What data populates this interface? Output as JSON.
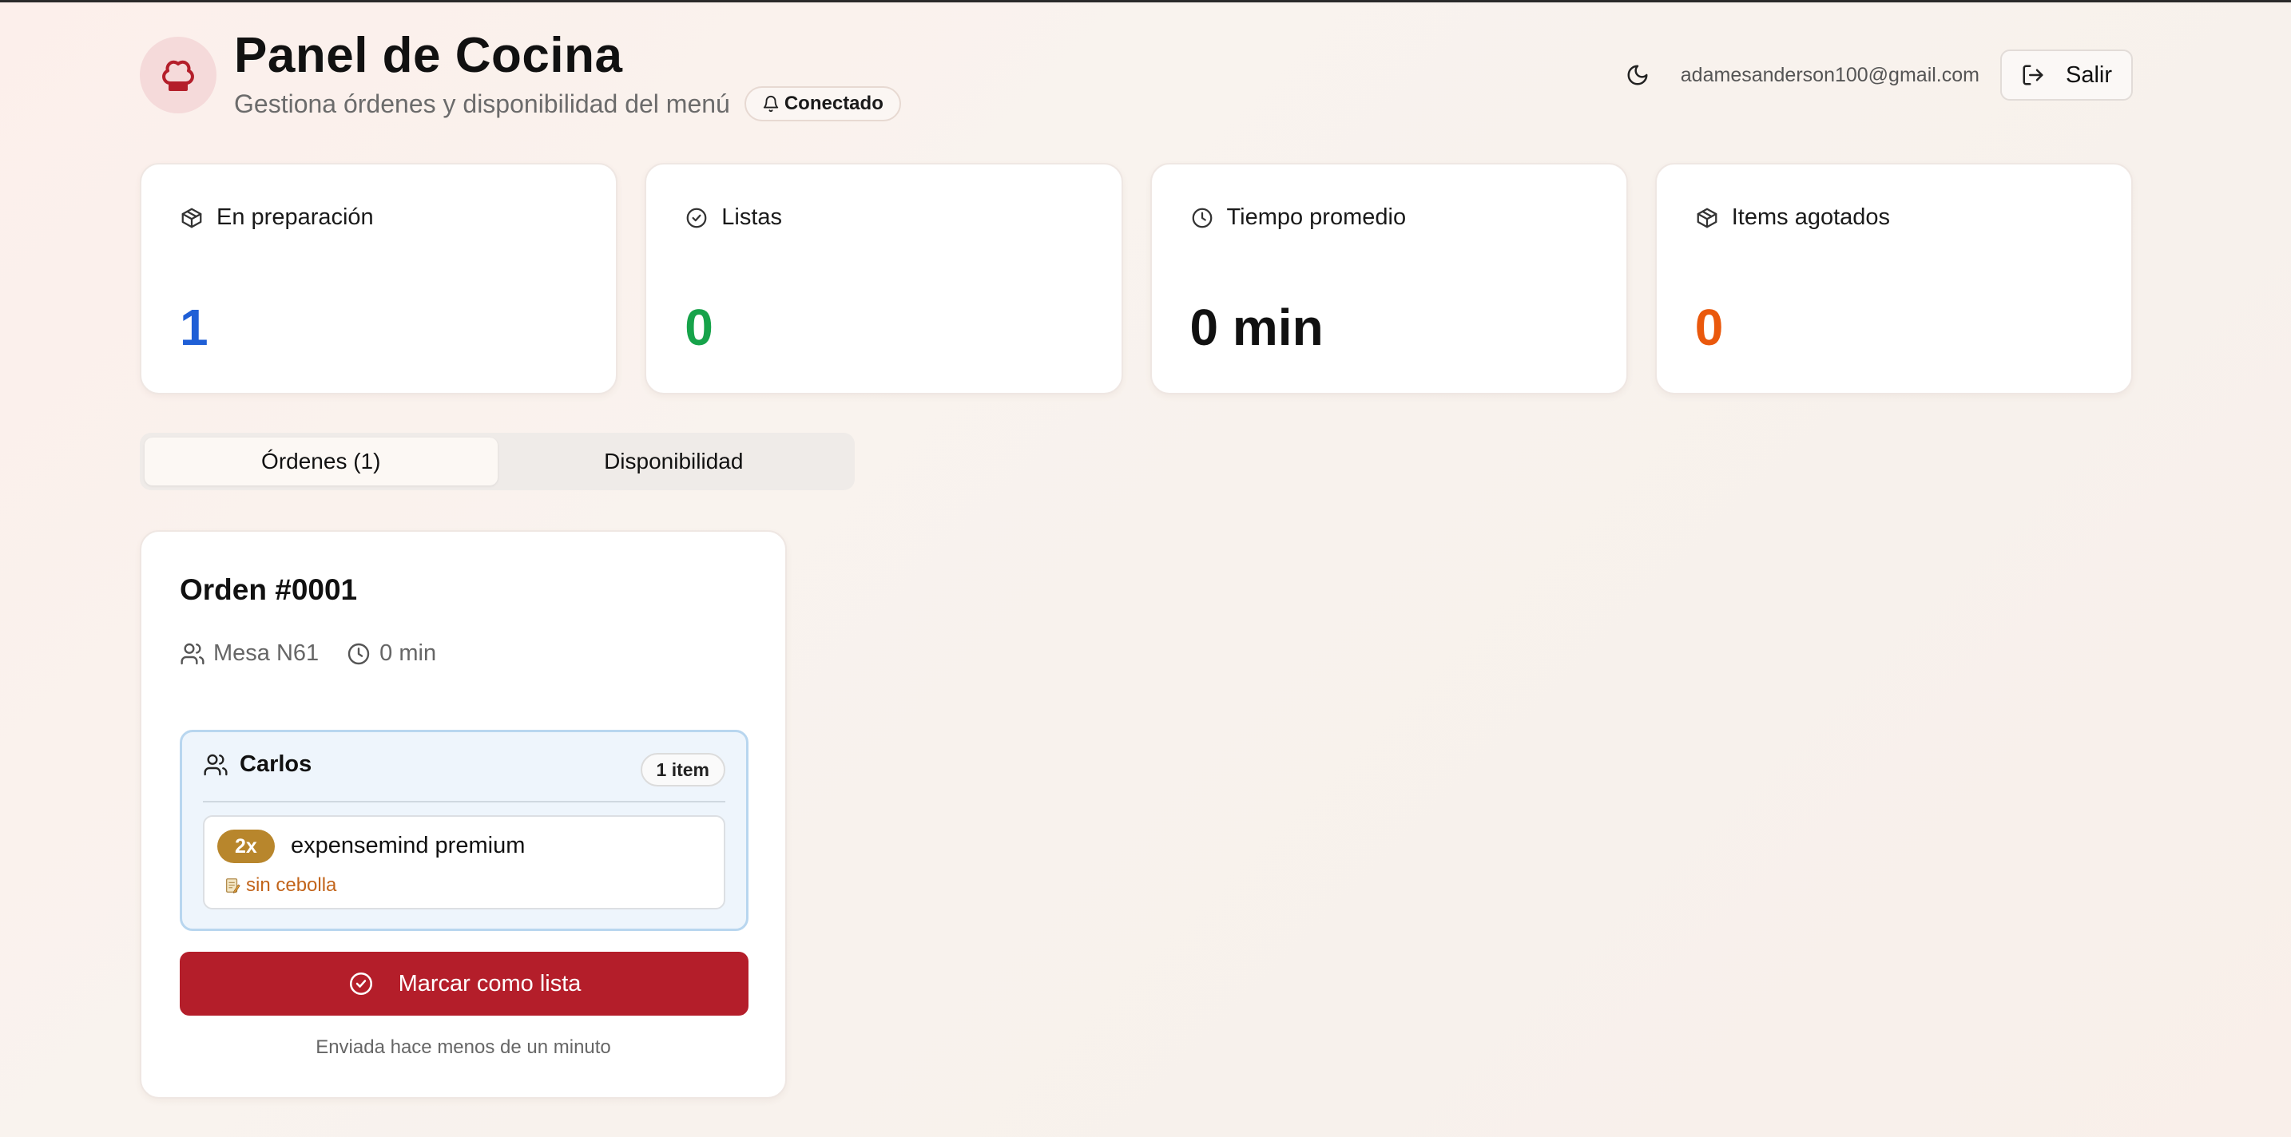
{
  "header": {
    "title": "Panel de Cocina",
    "subtitle": "Gestiona órdenes y disponibilidad del menú",
    "status_badge": "Conectado",
    "email": "adamesanderson100@gmail.com",
    "logout_label": "Salir"
  },
  "stats": [
    {
      "label": "En preparación",
      "value": "1",
      "color": "#1f5fd6",
      "icon": "box-icon"
    },
    {
      "label": "Listas",
      "value": "0",
      "color": "#16a34a",
      "icon": "check-circle-icon"
    },
    {
      "label": "Tiempo promedio",
      "value": "0 min",
      "color": "#111111",
      "icon": "clock-icon"
    },
    {
      "label": "Items agotados",
      "value": "0",
      "color": "#ea580c",
      "icon": "box-icon"
    }
  ],
  "tabs": [
    {
      "label": "Órdenes (1)",
      "active": true
    },
    {
      "label": "Disponibilidad",
      "active": false
    }
  ],
  "order": {
    "title": "Orden #0001",
    "table": "Mesa N61",
    "elapsed": "0 min",
    "diner": {
      "name": "Carlos",
      "count": "1 item",
      "items": [
        {
          "qty": "2x",
          "name": "expensemind premium",
          "note": "sin cebolla"
        }
      ]
    },
    "action_label": "Marcar como lista",
    "sent_text": "Enviada hace menos de un minuto"
  },
  "colors": {
    "accent": "#b41e2a",
    "qty_badge": "#b8862c",
    "note": "#c2641a",
    "diner_bg": "#eef5fc",
    "diner_border": "#b8d6ef"
  }
}
